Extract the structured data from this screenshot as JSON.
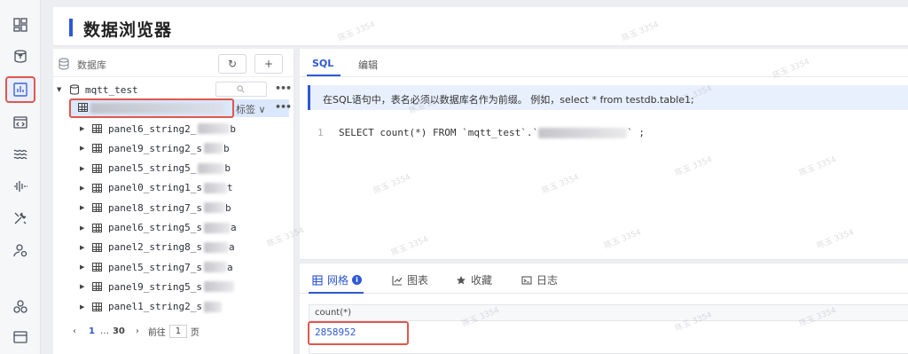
{
  "rail": {
    "items": [
      {
        "name": "dashboard-icon",
        "active": false
      },
      {
        "name": "database-upload-icon",
        "active": false
      },
      {
        "name": "data-browser-icon",
        "active": true
      },
      {
        "name": "code-window-icon",
        "active": false
      },
      {
        "name": "stream-waves-icon",
        "active": false
      },
      {
        "name": "wave-signal-icon",
        "active": false
      },
      {
        "name": "tools-icon",
        "active": false
      },
      {
        "name": "user-settings-icon",
        "active": false
      },
      {
        "name": "cluster-icon",
        "active": false
      },
      {
        "name": "window-panel-icon",
        "active": false
      }
    ]
  },
  "header": {
    "title": "数据浏览器"
  },
  "dbpanel": {
    "label": "数据库",
    "refresh_label": "↻",
    "add_label": "+",
    "database": "mqtt_test",
    "selected_table_tag": "标签 ∨",
    "tables": [
      {
        "visible": "panel6_string2_",
        "tail": "b"
      },
      {
        "visible": "panel9_string2_s",
        "tail": "b"
      },
      {
        "visible": "panel5_string5_",
        "tail": "b"
      },
      {
        "visible": "panel0_string1_s",
        "tail": "t"
      },
      {
        "visible": "panel8_string7_s",
        "tail": "b"
      },
      {
        "visible": "panel6_string5_s",
        "tail": "a"
      },
      {
        "visible": "panel2_string8_s",
        "tail": "a"
      },
      {
        "visible": "panel5_string7_s",
        "tail": "a"
      },
      {
        "visible": "panel9_string5_s",
        "tail": ""
      },
      {
        "visible": "panel1_string2_s",
        "tail": ""
      }
    ],
    "pager": {
      "current": "1",
      "ellipsis": "…",
      "last": "30",
      "goto_label": "前往",
      "goto_value": "1",
      "page_label": "页"
    }
  },
  "sql": {
    "tabs": [
      "SQL",
      "编辑"
    ],
    "notice": "在SQL语句中，表名必须以数据库名作为前缀。 例如，select * from testdb.table1;",
    "line_number": "1",
    "code_before": "SELECT count(*) FROM `mqtt_test`.`",
    "code_after": "` ;"
  },
  "results": {
    "tabs": [
      {
        "label": "网格",
        "icon": "grid-icon"
      },
      {
        "label": "图表",
        "icon": "chart-icon"
      },
      {
        "label": "收藏",
        "icon": "star-icon"
      },
      {
        "label": "日志",
        "icon": "log-icon"
      }
    ],
    "info_badge": "i",
    "column": "count(*)",
    "value": "2858952"
  },
  "watermark": "陈玉 3354",
  "colors": {
    "accent": "#2e58d6",
    "highlight_outline": "#e0574d",
    "notice_bg": "#e8f0fd",
    "selected_row_bg": "#dbe7fb"
  }
}
